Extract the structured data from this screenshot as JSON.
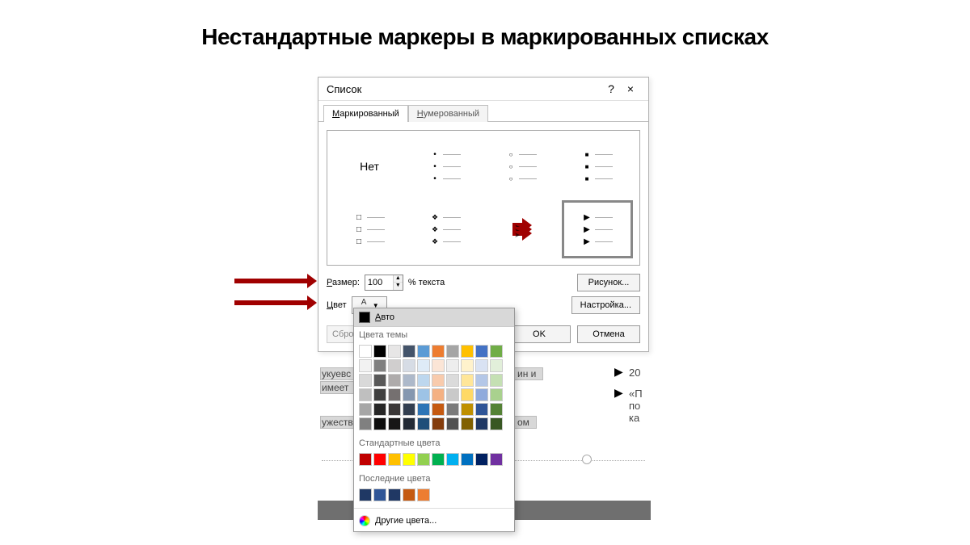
{
  "page": {
    "title": "Нестандартные маркеры в маркированных списках"
  },
  "dialog": {
    "title": "Список",
    "help": "?",
    "close": "×",
    "tabs": {
      "bulleted": "Маркированный",
      "numbered": "Нумерованный"
    },
    "none_label": "Нет",
    "size_label": "Размер:",
    "size_value": "100",
    "size_suffix": "% текста",
    "color_label": "Цвет",
    "picture_btn": "Рисунок...",
    "customize_btn": "Настройка...",
    "reset_btn": "Сбро",
    "ok_btn": "OK",
    "cancel_btn": "Отмена"
  },
  "color_popup": {
    "auto": "Авто",
    "theme_header": "Цвета темы",
    "standard_header": "Стандартные цвета",
    "recent_header": "Последние цвета",
    "more": "Другие цвета...",
    "theme_base": [
      "#ffffff",
      "#000000",
      "#e7e6e6",
      "#44546a",
      "#5b9bd5",
      "#ed7d31",
      "#a5a5a5",
      "#ffc000",
      "#4472c4",
      "#70ad47"
    ],
    "theme_tints": [
      [
        "#f2f2f2",
        "#808080",
        "#d0cece",
        "#d6dce5",
        "#deebf7",
        "#fbe5d6",
        "#ededed",
        "#fff2cc",
        "#d9e2f3",
        "#e2efda"
      ],
      [
        "#d9d9d9",
        "#595959",
        "#aeabab",
        "#adb9ca",
        "#bdd7ee",
        "#f8cbad",
        "#dbdbdb",
        "#ffe699",
        "#b4c7e7",
        "#c5e0b4"
      ],
      [
        "#bfbfbf",
        "#404040",
        "#757070",
        "#8497b0",
        "#9dc3e6",
        "#f4b183",
        "#c9c9c9",
        "#ffd966",
        "#8faadc",
        "#a9d18e"
      ],
      [
        "#a6a6a6",
        "#262626",
        "#3b3838",
        "#333f50",
        "#2e75b6",
        "#c55a11",
        "#7b7b7b",
        "#bf9000",
        "#2f5597",
        "#548235"
      ],
      [
        "#808080",
        "#0d0d0d",
        "#171616",
        "#222a35",
        "#1f4e79",
        "#843c0c",
        "#525252",
        "#806000",
        "#1f3864",
        "#385723"
      ]
    ],
    "standard": [
      "#c00000",
      "#ff0000",
      "#ffc000",
      "#ffff00",
      "#92d050",
      "#00b050",
      "#00b0f0",
      "#0070c0",
      "#002060",
      "#7030a0"
    ],
    "recent": [
      "#1f3864",
      "#2f5597",
      "#203864",
      "#c55a11",
      "#ed7d31"
    ]
  },
  "bg": {
    "frag1": "укуевс",
    "frag2": "имеет",
    "frag3": "ужеств",
    "frag4": "ин и",
    "frag5": "ом",
    "right1": "20",
    "right2": "«П",
    "right3": "по",
    "right4": "ка"
  }
}
